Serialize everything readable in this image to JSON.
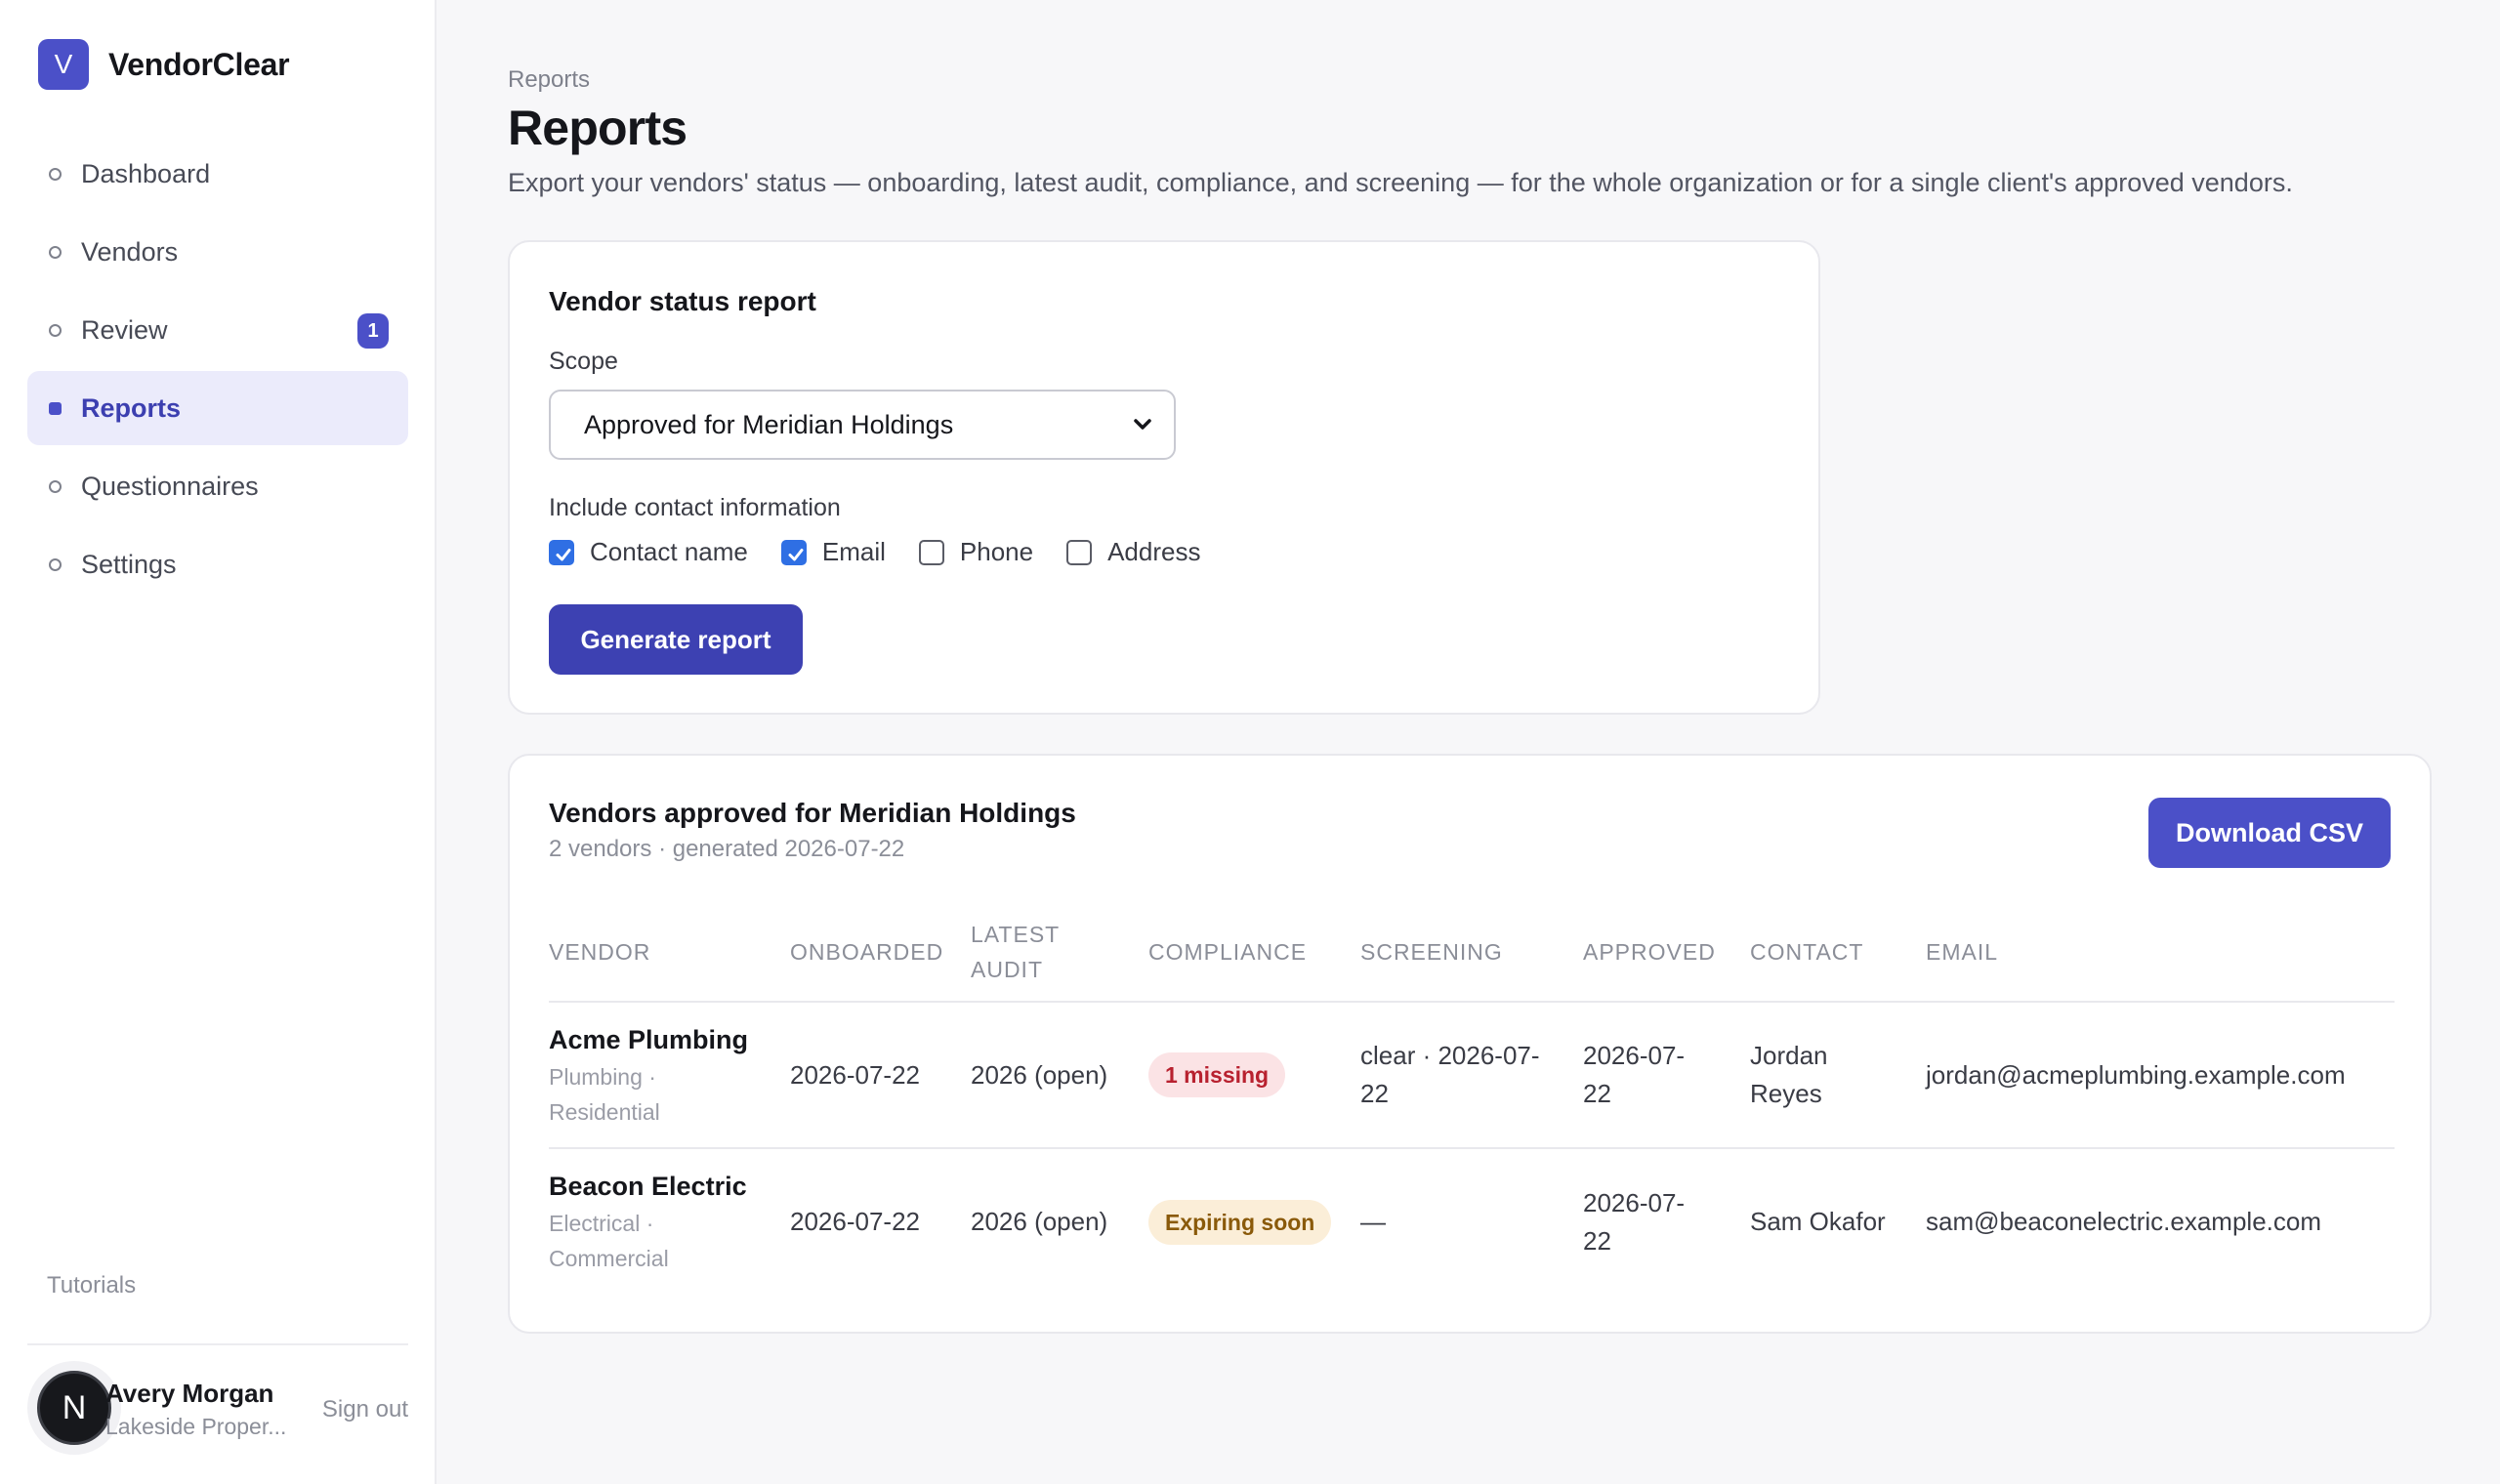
{
  "app": {
    "logo_letter": "V",
    "name": "VendorClear"
  },
  "sidebar": {
    "items": [
      {
        "label": "Dashboard"
      },
      {
        "label": "Vendors"
      },
      {
        "label": "Review",
        "badge": "1"
      },
      {
        "label": "Reports",
        "active": true
      },
      {
        "label": "Questionnaires"
      },
      {
        "label": "Settings"
      }
    ],
    "tutorials": "Tutorials",
    "user": {
      "initial": "N",
      "name": "Avery Morgan",
      "org": "Lakeside Proper...",
      "signout": "Sign out"
    }
  },
  "page": {
    "breadcrumb": "Reports",
    "title": "Reports",
    "subtitle": "Export your vendors' status — onboarding, latest audit, compliance, and screening — for the whole organization or for a single client's approved vendors."
  },
  "form": {
    "title": "Vendor status report",
    "scope_label": "Scope",
    "scope_value": "Approved for Meridian Holdings",
    "contact_label": "Include contact information",
    "options": [
      {
        "label": "Contact name",
        "checked": true
      },
      {
        "label": "Email",
        "checked": true
      },
      {
        "label": "Phone",
        "checked": false
      },
      {
        "label": "Address",
        "checked": false
      }
    ],
    "generate_label": "Generate report"
  },
  "results": {
    "title": "Vendors approved for Meridian Holdings",
    "meta": "2 vendors · generated 2026-07-22",
    "download_label": "Download CSV",
    "columns": [
      "Vendor",
      "Onboarded",
      "Latest audit",
      "Compliance",
      "Screening",
      "Approved",
      "Contact",
      "Email"
    ],
    "rows": [
      {
        "vendor": "Acme Plumbing",
        "category": "Plumbing · Residential",
        "onboarded": "2026-07-22",
        "audit": "2026 (open)",
        "compliance": "1 missing",
        "compliance_color": "#b8212f",
        "screening": "clear · 2026-07-22",
        "approved": "2026-07-22",
        "contact": "Jordan Reyes",
        "email": "jordan@acmeplumbing.example.com"
      },
      {
        "vendor": "Beacon Electric",
        "category": "Electrical · Commercial",
        "onboarded": "2026-07-22",
        "audit": "2026 (open)",
        "compliance": "Expiring soon",
        "compliance_color": "#8a5a0a",
        "screening": "—",
        "approved": "2026-07-22",
        "contact": "Sam Okafor",
        "email": "sam@beaconelectric.example.com"
      }
    ]
  },
  "colors": {
    "accent": "#4b50c8",
    "accent_dark": "#3d41b2",
    "checkbox": "#2f6fe4"
  }
}
